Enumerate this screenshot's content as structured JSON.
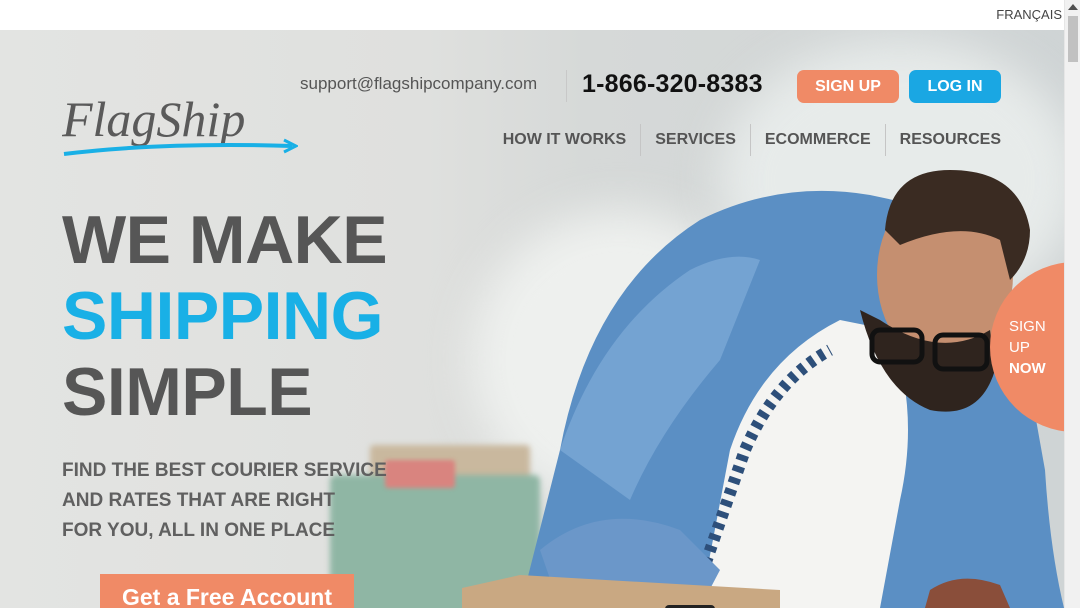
{
  "language": "FRANÇAIS",
  "header": {
    "logo_text": "FlagShip",
    "email": "support@flagshipcompany.com",
    "phone": "1-866-320-8383",
    "signup_label": "SIGN UP",
    "login_label": "LOG IN"
  },
  "nav": {
    "items": [
      {
        "label": "HOW IT WORKS"
      },
      {
        "label": "SERVICES"
      },
      {
        "label": "ECOMMERCE"
      },
      {
        "label": "RESOURCES"
      }
    ]
  },
  "hero": {
    "line1": "WE MAKE",
    "line2": "SHIPPING",
    "line3": "SIMPLE",
    "sub1": "FIND THE BEST COURIER SERVICE",
    "sub2": "AND RATES THAT ARE RIGHT",
    "sub3": "FOR YOU, ALL IN ONE PLACE",
    "cta_label": "Get a Free Account"
  },
  "side_badge": {
    "line1": "SIGN",
    "line2": "UP",
    "line3": "NOW"
  },
  "colors": {
    "accent_orange": "#f08a66",
    "accent_blue": "#1aa7e3",
    "headline_gray": "#565656"
  }
}
